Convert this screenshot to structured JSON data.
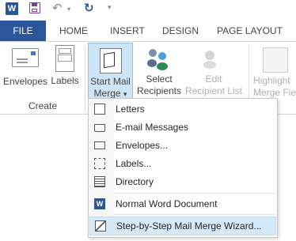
{
  "qat": {
    "app_icon_label": "W",
    "undo_glyph": "↶",
    "redo_glyph": "↻",
    "dropdown_glyph": "▾",
    "customize_glyph": "▾"
  },
  "tabs": [
    "FILE",
    "HOME",
    "INSERT",
    "DESIGN",
    "PAGE LAYOUT"
  ],
  "ribbon": {
    "create_group": {
      "envelopes": "Envelopes",
      "labels": "Labels",
      "group_label": "Create"
    },
    "start_mail_merge": {
      "line1": "Start Mail",
      "line2": "Merge",
      "arrow": "▾"
    },
    "select_recipients": {
      "line1": "Select",
      "line2": "Recipients",
      "arrow": "▾"
    },
    "edit_recipient_list": {
      "line1": "Edit",
      "line2": "Recipient List"
    },
    "highlight_merge_fields": {
      "line1": "Highlight",
      "line2": "Merge Fie"
    }
  },
  "menu": {
    "items": [
      {
        "label": "Letters",
        "icon": "letter-page-icon"
      },
      {
        "label": "E-mail Messages",
        "icon": "envelope-open-icon"
      },
      {
        "label": "Envelopes...",
        "icon": "envelope-icon"
      },
      {
        "label": "Labels...",
        "icon": "labels-icon"
      },
      {
        "label": "Directory",
        "icon": "directory-icon"
      },
      {
        "label": "Normal Word Document",
        "icon": "word-doc-icon"
      },
      {
        "label": "Step-by-Step Mail Merge Wizard...",
        "icon": "wizard-icon"
      }
    ]
  },
  "colors": {
    "file_tab": "#2b579a",
    "active_button": "#cde6f7",
    "menu_highlight": "#d6e9f8"
  }
}
